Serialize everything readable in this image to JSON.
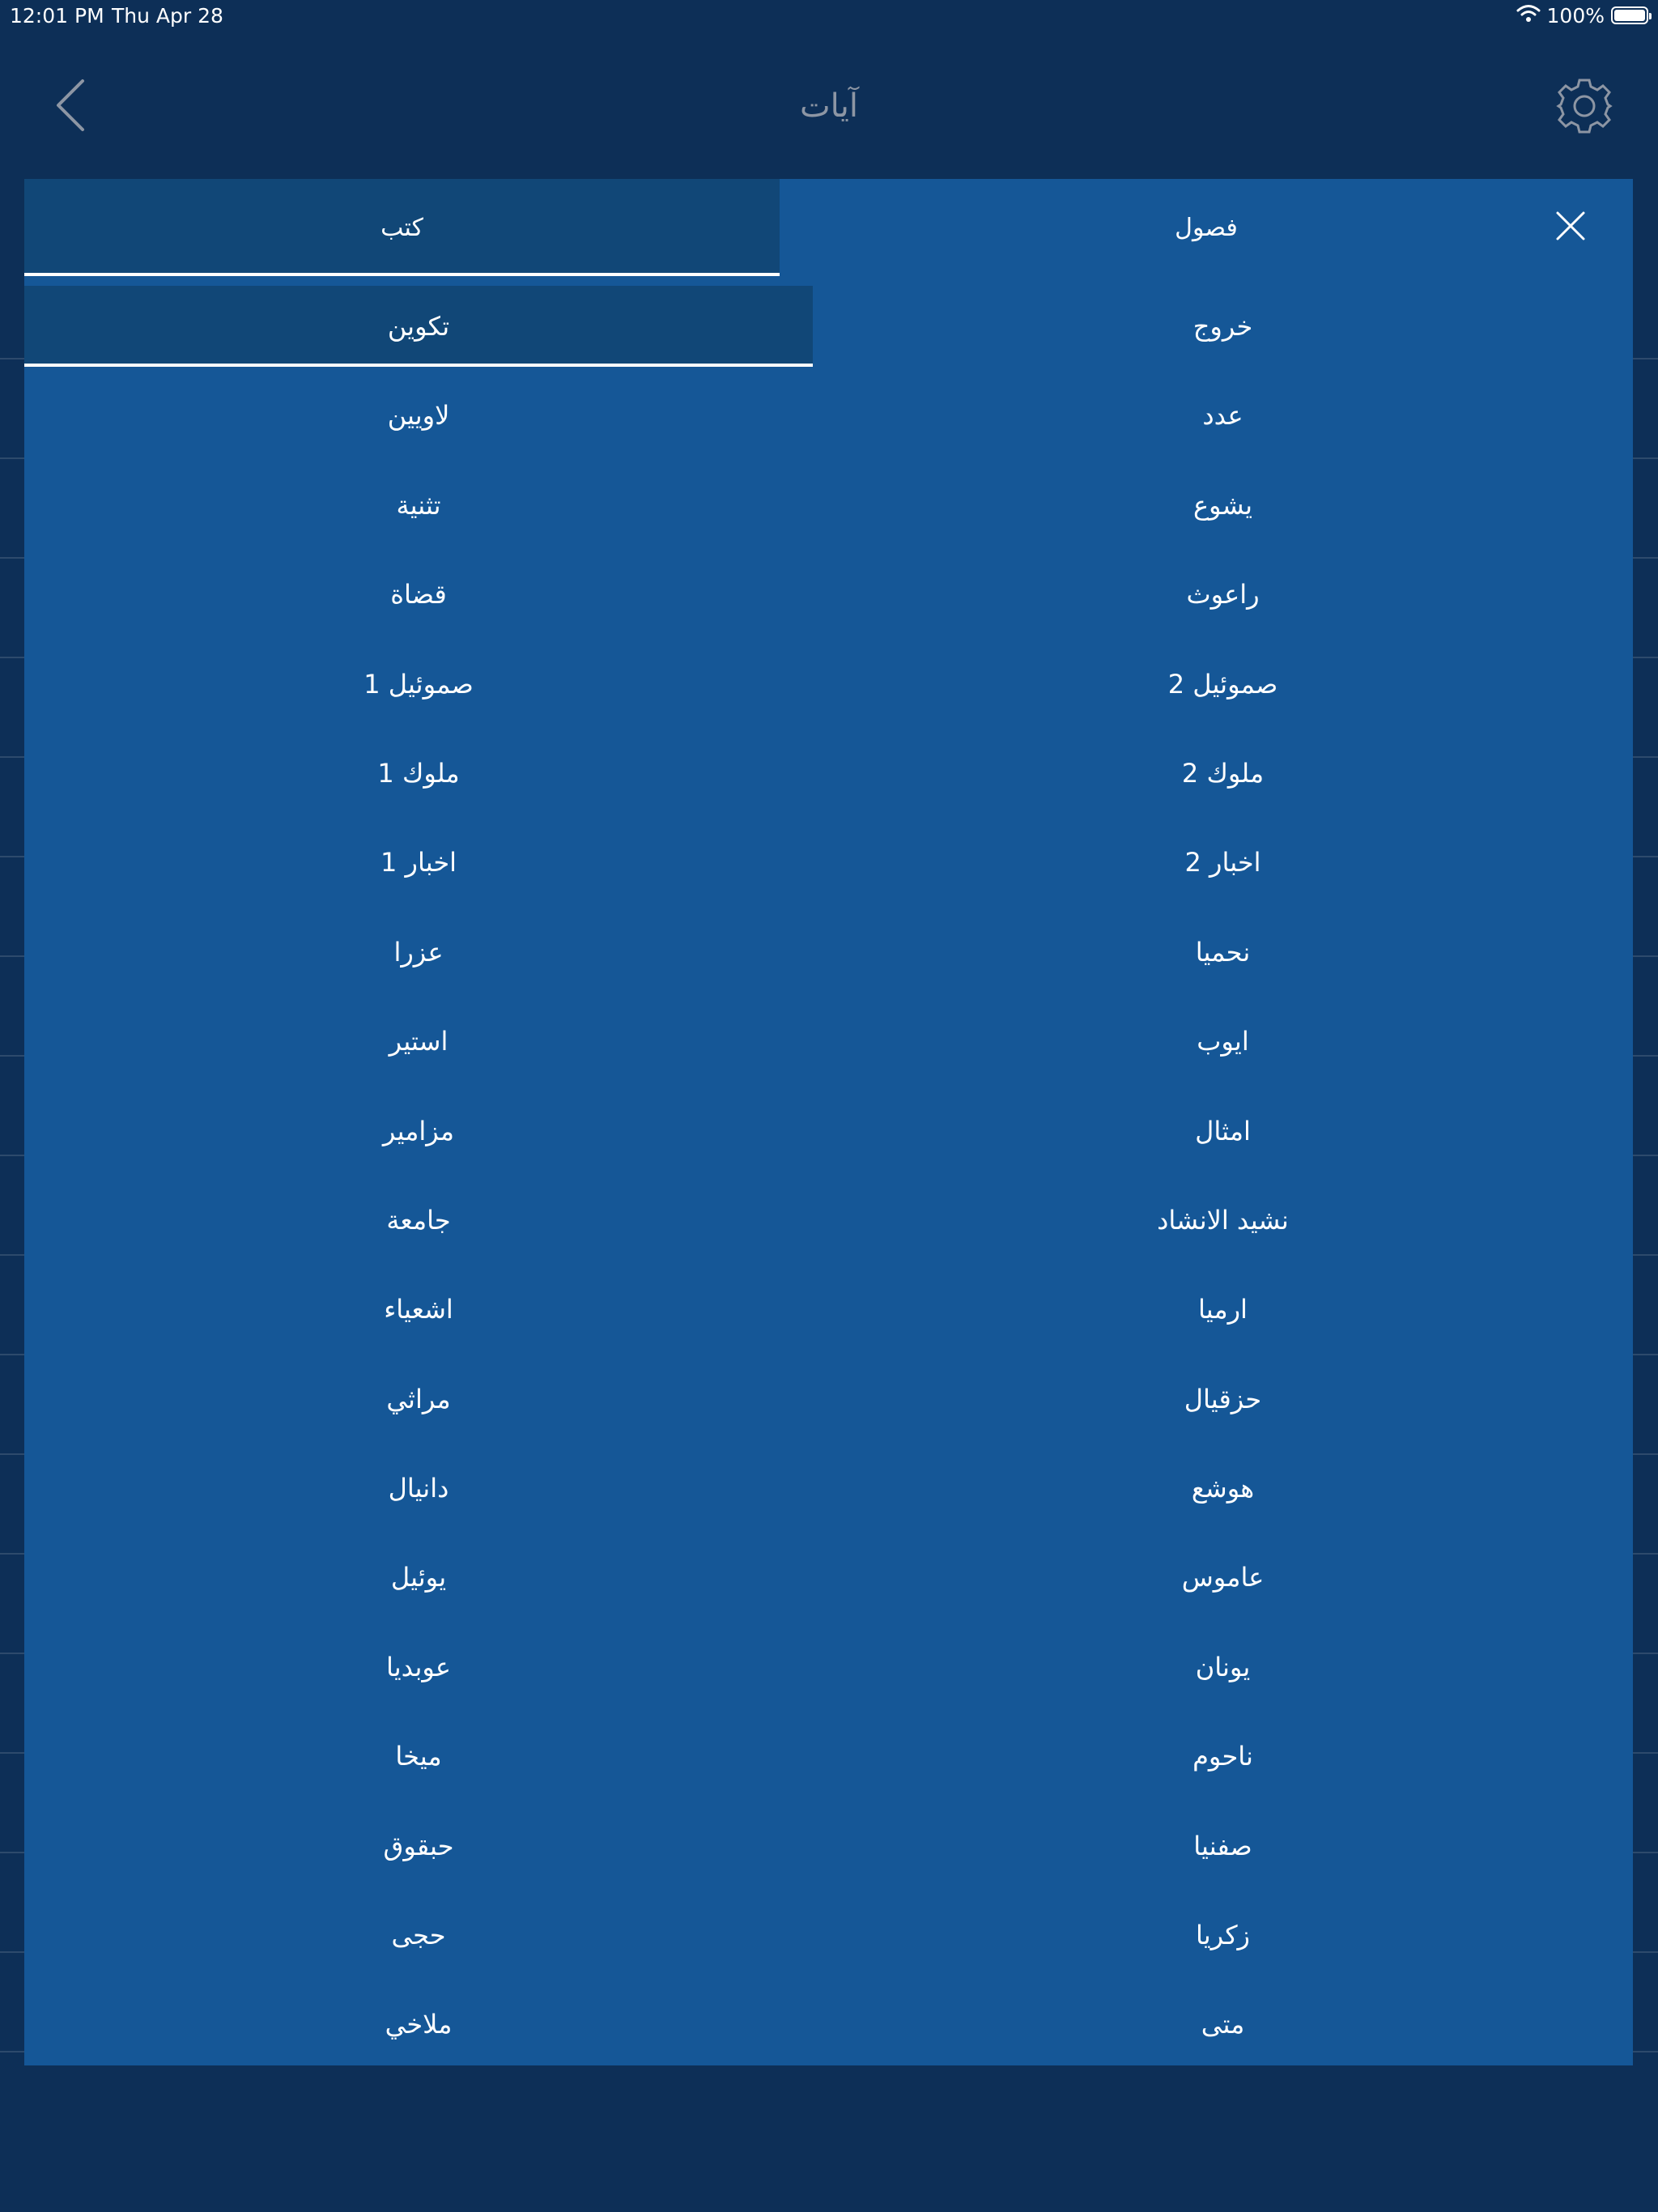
{
  "status_bar": {
    "time": "12:01 PM",
    "date": "Thu Apr 28",
    "battery": "100%",
    "battery_level": 1.0
  },
  "nav": {
    "title": "آيات",
    "back_icon": "chevron-left-icon",
    "settings_icon": "gear-icon"
  },
  "picker": {
    "tabs": [
      {
        "label": "كتب",
        "selected": true
      },
      {
        "label": "فصول",
        "selected": false
      }
    ],
    "close_icon": "close-icon",
    "books": [
      [
        "تكوين",
        "خروج"
      ],
      [
        "لاويين",
        "عدد"
      ],
      [
        "تثنية",
        "يشوع"
      ],
      [
        "قضاة",
        "راعوث"
      ],
      [
        "1 صموئيل",
        "2 صموئيل"
      ],
      [
        "1 ملوك",
        "2 ملوك"
      ],
      [
        "1 اخبار",
        "2 اخبار"
      ],
      [
        "عزرا",
        "نحميا"
      ],
      [
        "استير",
        "ايوب"
      ],
      [
        "مزامير",
        "امثال"
      ],
      [
        "جامعة",
        "نشيد الانشاد"
      ],
      [
        "اشعياء",
        "ارميا"
      ],
      [
        "مراثي",
        "حزقيال"
      ],
      [
        "دانيال",
        "هوشع"
      ],
      [
        "يوئيل",
        "عاموس"
      ],
      [
        "عوبديا",
        "يونان"
      ],
      [
        "ميخا",
        "ناحوم"
      ],
      [
        "حبقوق",
        "صفنيا"
      ],
      [
        "حجى",
        "زكريا"
      ],
      [
        "ملاخي",
        "متى"
      ]
    ],
    "selected_book": "تكوين"
  },
  "colors": {
    "background": "#0d2f57",
    "modal": "#155797",
    "selected": "#114777",
    "title": "#8d96a4"
  }
}
